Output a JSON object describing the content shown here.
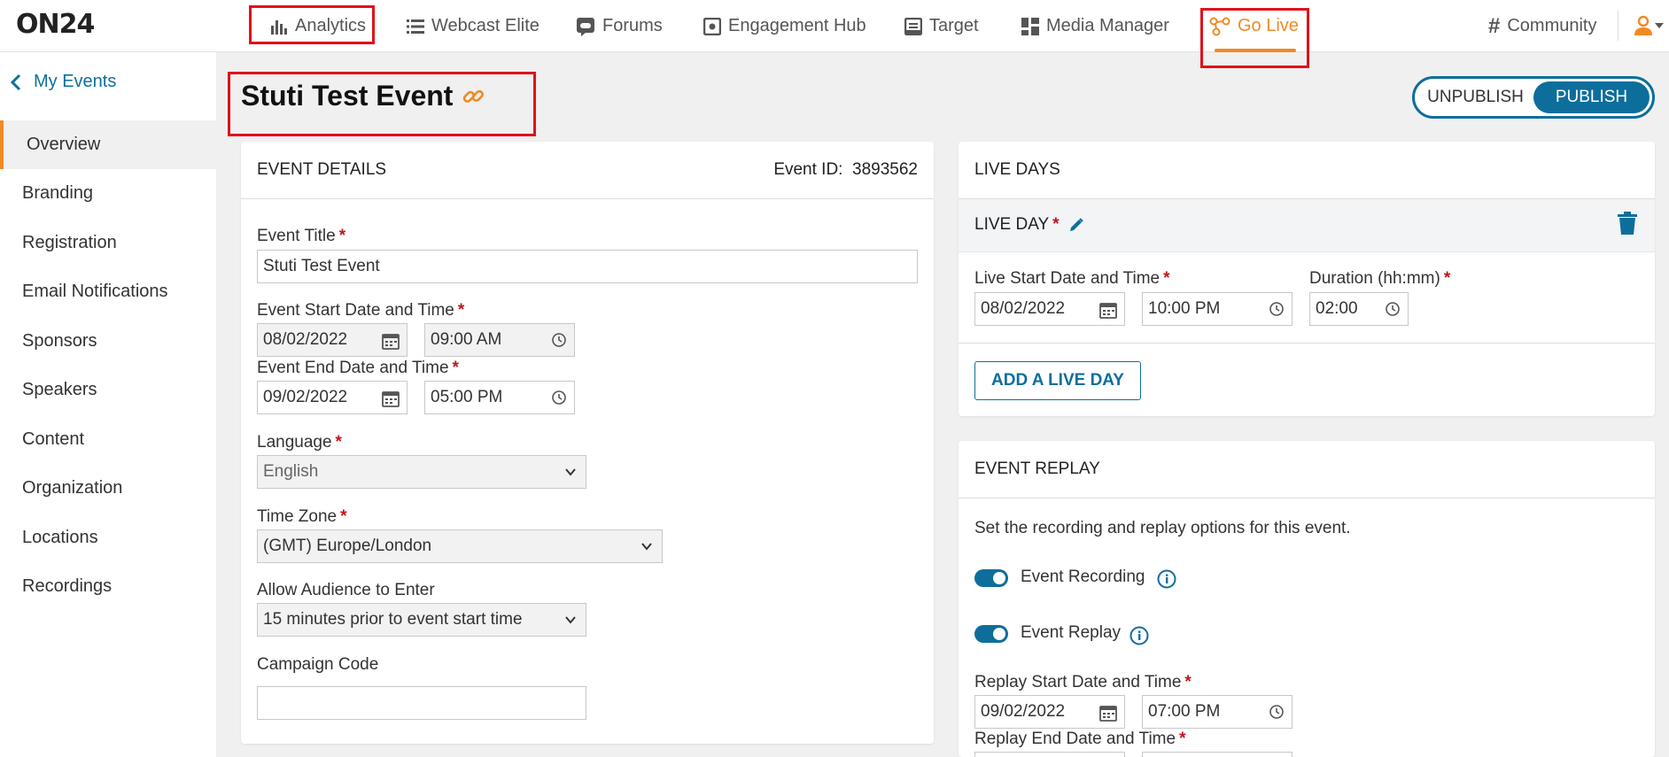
{
  "brand": {
    "logo_text": "ON24",
    "accent": "#f08a24",
    "primary": "#0d6e9c",
    "highlight": "#e0101a"
  },
  "nav": {
    "items": [
      {
        "label": "Analytics",
        "icon": "bar-chart-icon"
      },
      {
        "label": "Webcast Elite",
        "icon": "list-icon"
      },
      {
        "label": "Forums",
        "icon": "chat-icon"
      },
      {
        "label": "Engagement Hub",
        "icon": "hub-icon"
      },
      {
        "label": "Target",
        "icon": "target-icon"
      },
      {
        "label": "Media Manager",
        "icon": "grid-icon"
      },
      {
        "label": "Go Live",
        "icon": "go-live-icon"
      }
    ],
    "active": "Go Live",
    "community_label": "Community"
  },
  "sidebar": {
    "back_label": "My Events",
    "items": [
      {
        "label": "Overview"
      },
      {
        "label": "Branding"
      },
      {
        "label": "Registration"
      },
      {
        "label": "Email Notifications"
      },
      {
        "label": "Sponsors"
      },
      {
        "label": "Speakers"
      },
      {
        "label": "Content"
      },
      {
        "label": "Organization"
      },
      {
        "label": "Locations"
      },
      {
        "label": "Recordings"
      }
    ],
    "active": "Overview"
  },
  "header": {
    "title": "Stuti Test Event",
    "unpublish_label": "UNPUBLISH",
    "publish_label": "PUBLISH",
    "selected": "PUBLISH"
  },
  "event_details": {
    "heading": "EVENT DETAILS",
    "event_id_label": "Event ID:",
    "event_id": "3893562",
    "title_label": "Event Title",
    "title_value": "Stuti Test Event",
    "start_label": "Event Start Date and Time",
    "start_date": "08/02/2022",
    "start_time": "09:00 AM",
    "end_label": "Event End Date and Time",
    "end_date": "09/02/2022",
    "end_time": "05:00 PM",
    "language_label": "Language",
    "language_value": "English",
    "timezone_label": "Time Zone",
    "timezone_value": "(GMT) Europe/London",
    "audience_label": "Allow Audience to Enter",
    "audience_value": "15 minutes prior to event start time",
    "campaign_label": "Campaign Code",
    "campaign_value": ""
  },
  "live_days": {
    "heading": "LIVE DAYS",
    "day_label": "LIVE DAY",
    "start_label": "Live Start Date and Time",
    "start_date": "08/02/2022",
    "start_time": "10:00 PM",
    "duration_label": "Duration (hh:mm)",
    "duration_value": "02:00",
    "add_button": "ADD A LIVE DAY"
  },
  "event_replay": {
    "heading": "EVENT REPLAY",
    "description": "Set the recording and replay options for this event.",
    "recording_label": "Event Recording",
    "recording_on": true,
    "replay_label": "Event Replay",
    "replay_on": true,
    "replay_start_label": "Replay Start Date and Time",
    "replay_start_date": "09/02/2022",
    "replay_start_time": "07:00 PM",
    "replay_end_label": "Replay End Date and Time"
  }
}
